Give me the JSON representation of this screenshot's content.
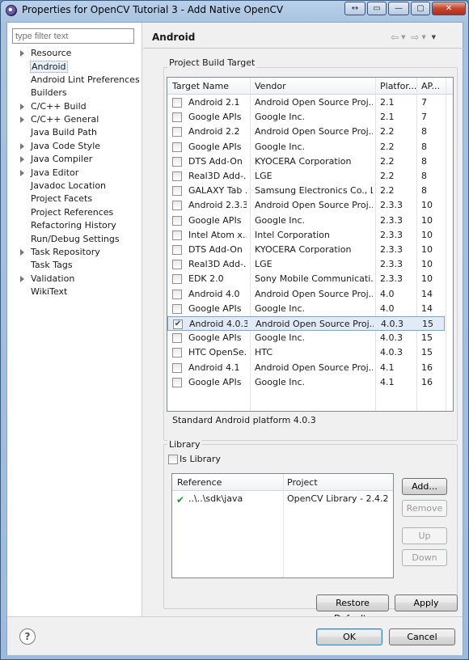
{
  "window": {
    "title": "Properties for OpenCV Tutorial 3 - Add Native OpenCV"
  },
  "titlebar_buttons": {
    "restore_icon": "↔",
    "min_icon": "▭",
    "max_icon": "—",
    "box_icon": "▢",
    "close_icon": "✕"
  },
  "filter": {
    "placeholder": "type filter text"
  },
  "tree": [
    {
      "label": "Resource",
      "expandable": true
    },
    {
      "label": "Android",
      "expandable": false,
      "selected": true
    },
    {
      "label": "Android Lint Preferences",
      "expandable": false
    },
    {
      "label": "Builders",
      "expandable": false
    },
    {
      "label": "C/C++ Build",
      "expandable": true
    },
    {
      "label": "C/C++ General",
      "expandable": true
    },
    {
      "label": "Java Build Path",
      "expandable": false
    },
    {
      "label": "Java Code Style",
      "expandable": true
    },
    {
      "label": "Java Compiler",
      "expandable": true
    },
    {
      "label": "Java Editor",
      "expandable": true
    },
    {
      "label": "Javadoc Location",
      "expandable": false
    },
    {
      "label": "Project Facets",
      "expandable": false
    },
    {
      "label": "Project References",
      "expandable": false
    },
    {
      "label": "Refactoring History",
      "expandable": false
    },
    {
      "label": "Run/Debug Settings",
      "expandable": false
    },
    {
      "label": "Task Repository",
      "expandable": true
    },
    {
      "label": "Task Tags",
      "expandable": false
    },
    {
      "label": "Validation",
      "expandable": true
    },
    {
      "label": "WikiText",
      "expandable": false
    }
  ],
  "page": {
    "title": "Android"
  },
  "nav": {
    "back_icon": "⇦",
    "forward_icon": "⇨",
    "dropdown_icon": "▼",
    "menu_icon": "▼"
  },
  "build_target": {
    "group_label": "Project Build Target",
    "columns": [
      "Target Name",
      "Vendor",
      "Platfor...",
      "AP..."
    ],
    "rows": [
      {
        "checked": false,
        "name": "Android 2.1",
        "vendor": "Android Open Source Proj...",
        "platform": "2.1",
        "api": "7"
      },
      {
        "checked": false,
        "name": "Google APIs",
        "vendor": "Google Inc.",
        "platform": "2.1",
        "api": "7"
      },
      {
        "checked": false,
        "name": "Android 2.2",
        "vendor": "Android Open Source Proj...",
        "platform": "2.2",
        "api": "8"
      },
      {
        "checked": false,
        "name": "Google APIs",
        "vendor": "Google Inc.",
        "platform": "2.2",
        "api": "8"
      },
      {
        "checked": false,
        "name": "DTS Add-On",
        "vendor": "KYOCERA Corporation",
        "platform": "2.2",
        "api": "8"
      },
      {
        "checked": false,
        "name": "Real3D Add-...",
        "vendor": "LGE",
        "platform": "2.2",
        "api": "8"
      },
      {
        "checked": false,
        "name": "GALAXY Tab ...",
        "vendor": "Samsung Electronics Co., L...",
        "platform": "2.2",
        "api": "8"
      },
      {
        "checked": false,
        "name": "Android 2.3.3",
        "vendor": "Android Open Source Proj...",
        "platform": "2.3.3",
        "api": "10"
      },
      {
        "checked": false,
        "name": "Google APIs",
        "vendor": "Google Inc.",
        "platform": "2.3.3",
        "api": "10"
      },
      {
        "checked": false,
        "name": "Intel Atom x...",
        "vendor": "Intel Corporation",
        "platform": "2.3.3",
        "api": "10"
      },
      {
        "checked": false,
        "name": "DTS Add-On",
        "vendor": "KYOCERA Corporation",
        "platform": "2.3.3",
        "api": "10"
      },
      {
        "checked": false,
        "name": "Real3D Add-...",
        "vendor": "LGE",
        "platform": "2.3.3",
        "api": "10"
      },
      {
        "checked": false,
        "name": "EDK 2.0",
        "vendor": "Sony Mobile Communicati...",
        "platform": "2.3.3",
        "api": "10"
      },
      {
        "checked": false,
        "name": "Android 4.0",
        "vendor": "Android Open Source Proj...",
        "platform": "4.0",
        "api": "14"
      },
      {
        "checked": false,
        "name": "Google APIs",
        "vendor": "Google Inc.",
        "platform": "4.0",
        "api": "14"
      },
      {
        "checked": true,
        "name": "Android 4.0.3",
        "vendor": "Android Open Source Proj...",
        "platform": "4.0.3",
        "api": "15"
      },
      {
        "checked": false,
        "name": "Google APIs",
        "vendor": "Google Inc.",
        "platform": "4.0.3",
        "api": "15"
      },
      {
        "checked": false,
        "name": "HTC OpenSe...",
        "vendor": "HTC",
        "platform": "4.0.3",
        "api": "15"
      },
      {
        "checked": false,
        "name": "Android 4.1",
        "vendor": "Android Open Source Proj...",
        "platform": "4.1",
        "api": "16"
      },
      {
        "checked": false,
        "name": "Google APIs",
        "vendor": "Google Inc.",
        "platform": "4.1",
        "api": "16"
      }
    ],
    "description": "Standard Android platform 4.0.3"
  },
  "library": {
    "group_label": "Library",
    "is_library_label": "Is Library",
    "is_library_checked": false,
    "columns": [
      "Reference",
      "Project"
    ],
    "rows": [
      {
        "reference": "..\\..\\sdk\\java",
        "project": "OpenCV Library - 2.4.2",
        "status_icon": "✔"
      }
    ],
    "buttons": {
      "add": "Add...",
      "remove": "Remove",
      "up": "Up",
      "down": "Down"
    }
  },
  "actions": {
    "restore_defaults": "Restore Defaults",
    "apply": "Apply"
  },
  "dialog": {
    "help": "?",
    "ok": "OK",
    "cancel": "Cancel"
  }
}
